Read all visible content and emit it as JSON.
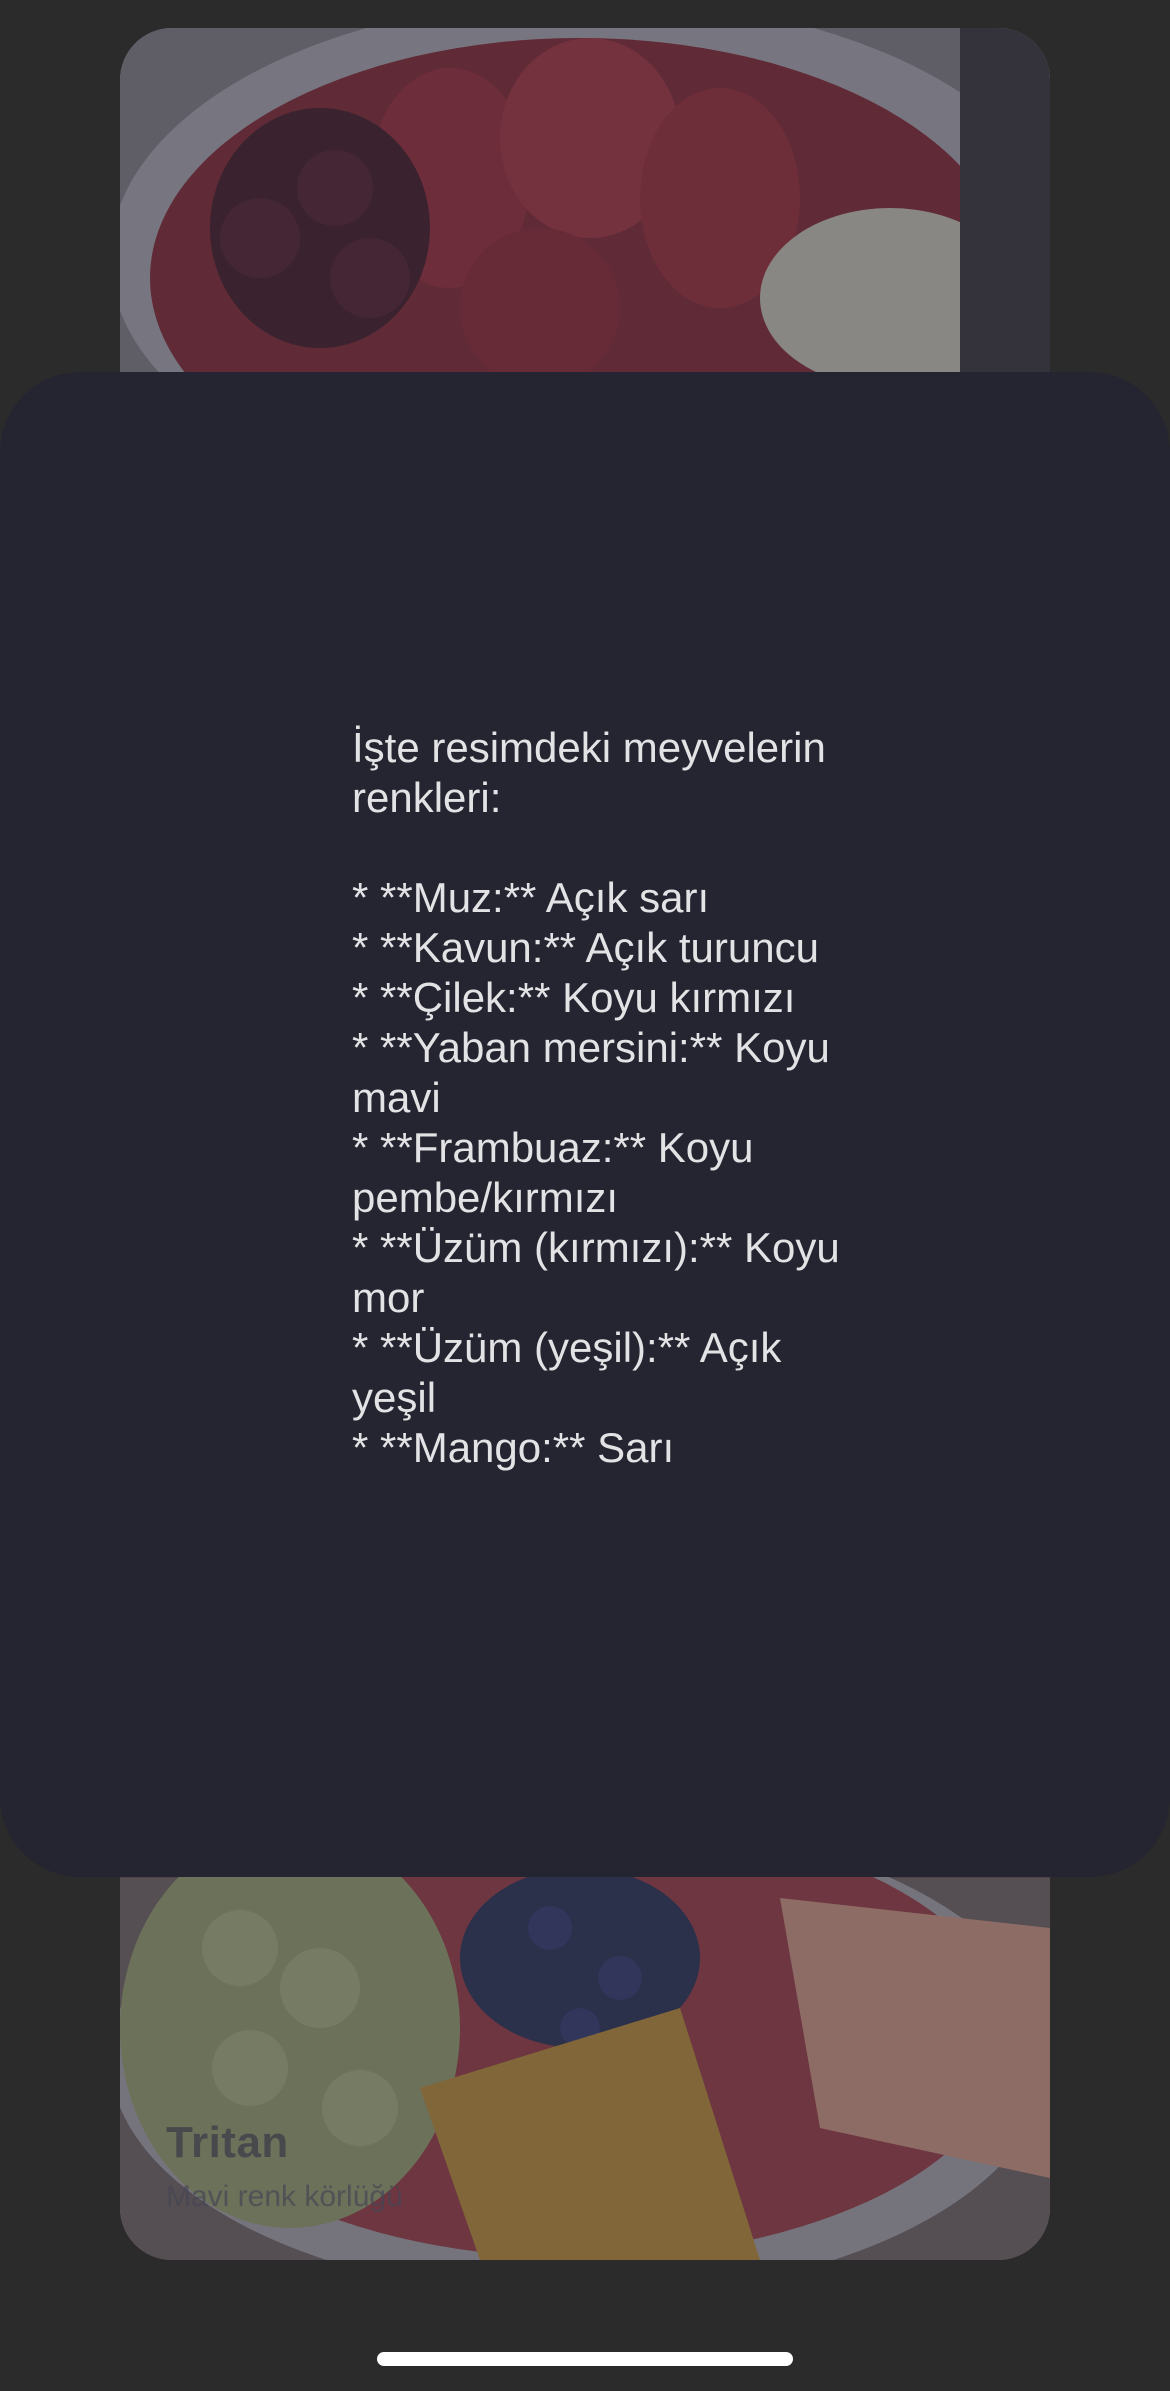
{
  "filter": {
    "name": "Tritan",
    "description": "Mavi renk körlüğü"
  },
  "description_text": "İşte resimdeki meyvelerin renkleri:\n\n* **Muz:** Açık sarı\n* **Kavun:** Açık turuncu\n* **Çilek:** Koyu kırmızı\n* **Yaban mersini:** Koyu mavi\n* **Frambuaz:** Koyu pembe/kırmızı\n* **Üzüm (kırmızı):** Koyu mor\n* **Üzüm (yeşil):** Açık yeşil\n* **Mango:** Sarı"
}
